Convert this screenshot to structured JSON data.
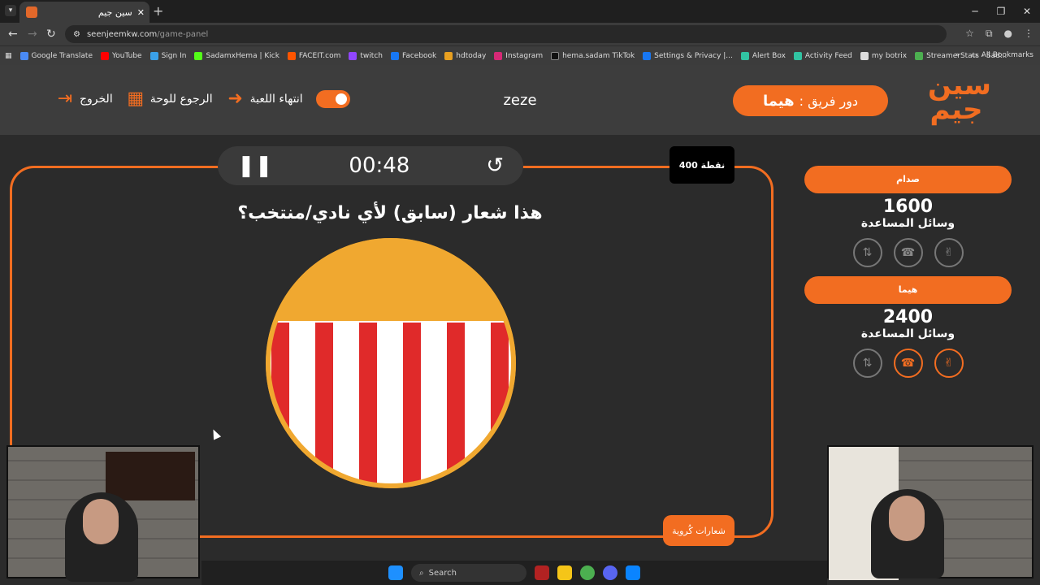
{
  "browser": {
    "tab_title": "سين جيم",
    "url_host": "seenjeemkw.com",
    "url_path": "/game-panel",
    "bookmarks": [
      "Google Translate",
      "YouTube",
      "Sign In",
      "SadamxHema | Kick",
      "FACEIT.com",
      "twitch",
      "Facebook",
      "hdtoday",
      "Instagram",
      "hema.sadam TikTok",
      "Settings & Privacy |...",
      "Alert Box",
      "Activity Feed",
      "my botrix",
      "StreamerStats - Sad..."
    ],
    "all_bookmarks": "All Bookmarks"
  },
  "header": {
    "logo_text": "سين جيم",
    "turn_label": "دور فريق :",
    "turn_team": "هيما",
    "game_name": "zeze",
    "end_game": "انتهاء اللعبة",
    "back_to_board": "الرجوع للوحة",
    "exit": "الخروج"
  },
  "board": {
    "timer": "00:48",
    "points": "400 نقطة",
    "question": "هذا شعار (سابق) لأي نادي/منتخب؟",
    "category": "شعارات كُروية"
  },
  "teams": [
    {
      "name": "صدام",
      "score": "1600",
      "aids_label": "وسائل المساعدة",
      "aids_active": [
        false,
        false,
        false
      ]
    },
    {
      "name": "هيما",
      "score": "2400",
      "aids_label": "وسائل المساعدة",
      "aids_active": [
        false,
        true,
        true
      ]
    }
  ],
  "taskbar": {
    "search": "Search"
  },
  "colors": {
    "accent": "#f26d21",
    "logo_yellow": "#f0a830",
    "stripe_red": "#e02a2a"
  }
}
